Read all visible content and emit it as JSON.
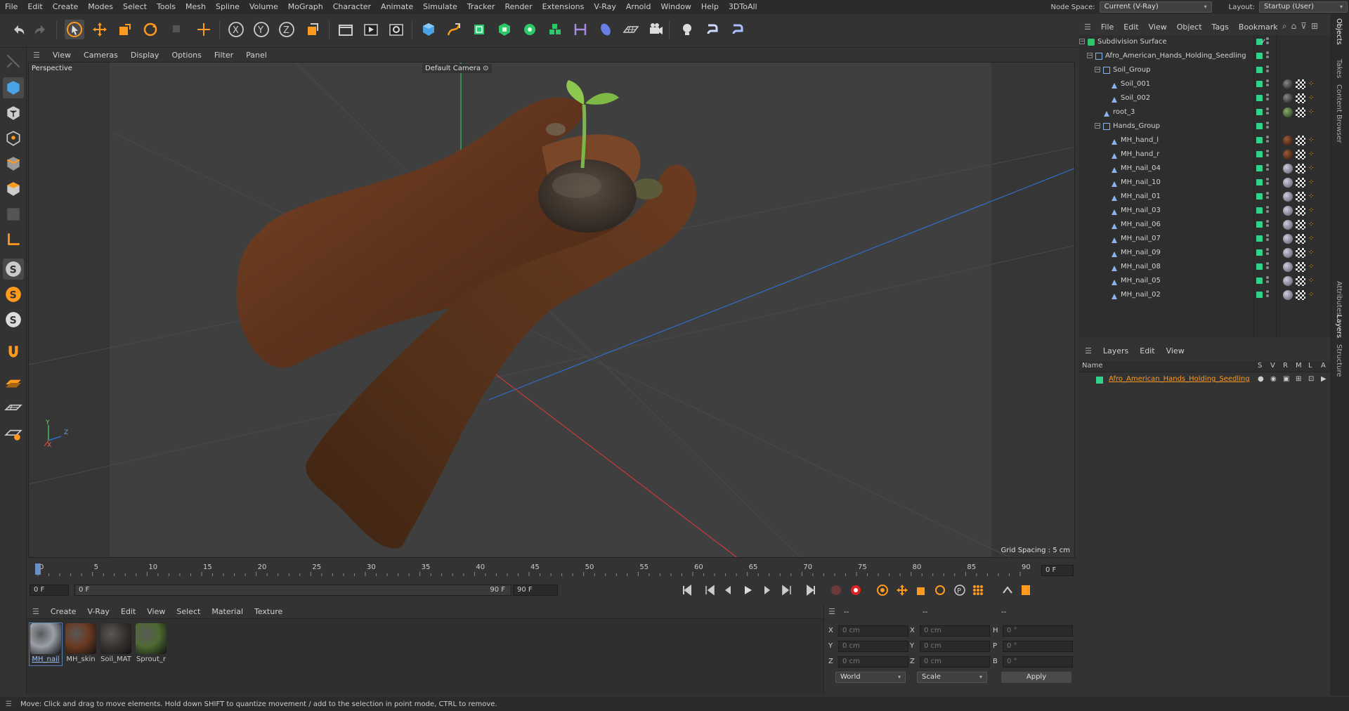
{
  "menubar": {
    "items": [
      "File",
      "Edit",
      "Create",
      "Modes",
      "Select",
      "Tools",
      "Mesh",
      "Spline",
      "Volume",
      "MoGraph",
      "Character",
      "Animate",
      "Simulate",
      "Tracker",
      "Render",
      "Extensions",
      "V-Ray",
      "Arnold",
      "Window",
      "Help",
      "3DToAll"
    ],
    "node_space_label": "Node Space:",
    "node_space_value": "Current (V-Ray)",
    "layout_label": "Layout:",
    "layout_value": "Startup (User)"
  },
  "viewport": {
    "menu": [
      "View",
      "Cameras",
      "Display",
      "Options",
      "Filter",
      "Panel"
    ],
    "view_name": "Perspective",
    "camera_label": "Default Camera",
    "grid_spacing": "Grid Spacing : 5 cm",
    "axis_y": "Y",
    "axis_z": "Z",
    "axis_x": "X"
  },
  "timeline": {
    "ticks": [
      "0",
      "5",
      "10",
      "15",
      "20",
      "25",
      "30",
      "35",
      "40",
      "45",
      "50",
      "55",
      "60",
      "65",
      "70",
      "75",
      "80",
      "85",
      "90"
    ],
    "current_frame_right": "0 F",
    "start_field": "0 F",
    "range_start": "0 F",
    "range_end": "90 F",
    "end_field": "90 F"
  },
  "materials": {
    "menu": [
      "Create",
      "V-Ray",
      "Edit",
      "View",
      "Select",
      "Material",
      "Texture"
    ],
    "items": [
      {
        "name": "MH_nail",
        "color": "#9aa0a8"
      },
      {
        "name": "MH_skin",
        "color": "#6b3a22"
      },
      {
        "name": "Soil_MAT",
        "color": "#3a3430"
      },
      {
        "name": "Sprout_r",
        "color": "#4e6b32"
      }
    ]
  },
  "coordinates": {
    "headers": [
      "--",
      "--",
      "--"
    ],
    "rows": [
      {
        "a": "X",
        "av": "0 cm",
        "b": "X",
        "bv": "0 cm",
        "c": "H",
        "cv": "0 °"
      },
      {
        "a": "Y",
        "av": "0 cm",
        "b": "Y",
        "bv": "0 cm",
        "c": "P",
        "cv": "0 °"
      },
      {
        "a": "Z",
        "av": "0 cm",
        "b": "Z",
        "bv": "0 cm",
        "c": "B",
        "cv": "0 °"
      }
    ],
    "space": "World",
    "mode": "Scale",
    "apply": "Apply"
  },
  "objects": {
    "menu": [
      "File",
      "Edit",
      "View",
      "Object",
      "Tags",
      "Bookmark"
    ],
    "tree": [
      {
        "name": "Subdivision Surface",
        "indent": 0,
        "type": "subd",
        "tags": []
      },
      {
        "name": "Afro_American_Hands_Holding_Seedling",
        "indent": 1,
        "type": "null",
        "tags": []
      },
      {
        "name": "Soil_Group",
        "indent": 2,
        "type": "null",
        "tags": []
      },
      {
        "name": "Soil_001",
        "indent": 3,
        "type": "poly",
        "tags": [
          "soil",
          "check",
          "dots"
        ]
      },
      {
        "name": "Soil_002",
        "indent": 3,
        "type": "poly",
        "tags": [
          "soil",
          "check",
          "dots"
        ]
      },
      {
        "name": "root_3",
        "indent": 2,
        "type": "poly",
        "tags": [
          "sprout",
          "check",
          "dots"
        ]
      },
      {
        "name": "Hands_Group",
        "indent": 2,
        "type": "null",
        "tags": []
      },
      {
        "name": "MH_hand_l",
        "indent": 3,
        "type": "poly",
        "tags": [
          "skin",
          "check",
          "dots"
        ]
      },
      {
        "name": "MH_hand_r",
        "indent": 3,
        "type": "poly",
        "tags": [
          "skin",
          "check",
          "dots"
        ]
      },
      {
        "name": "MH_nail_04",
        "indent": 3,
        "type": "poly",
        "tags": [
          "nail",
          "check",
          "dots"
        ]
      },
      {
        "name": "MH_nail_10",
        "indent": 3,
        "type": "poly",
        "tags": [
          "nail",
          "check",
          "dots"
        ]
      },
      {
        "name": "MH_nail_01",
        "indent": 3,
        "type": "poly",
        "tags": [
          "nail",
          "check",
          "dots"
        ]
      },
      {
        "name": "MH_nail_03",
        "indent": 3,
        "type": "poly",
        "tags": [
          "nail",
          "check",
          "dots"
        ]
      },
      {
        "name": "MH_nail_06",
        "indent": 3,
        "type": "poly",
        "tags": [
          "nail",
          "check",
          "dots"
        ]
      },
      {
        "name": "MH_nail_07",
        "indent": 3,
        "type": "poly",
        "tags": [
          "nail",
          "check",
          "dots"
        ]
      },
      {
        "name": "MH_nail_09",
        "indent": 3,
        "type": "poly",
        "tags": [
          "nail",
          "check",
          "dots"
        ]
      },
      {
        "name": "MH_nail_08",
        "indent": 3,
        "type": "poly",
        "tags": [
          "nail",
          "check",
          "dots"
        ]
      },
      {
        "name": "MH_nail_05",
        "indent": 3,
        "type": "poly",
        "tags": [
          "nail",
          "check",
          "dots"
        ]
      },
      {
        "name": "MH_nail_02",
        "indent": 3,
        "type": "poly",
        "tags": [
          "nail",
          "check",
          "dots"
        ]
      }
    ]
  },
  "layers": {
    "menu": [
      "Layers",
      "Edit",
      "View"
    ],
    "col_name": "Name",
    "cols": [
      "S",
      "V",
      "R",
      "M",
      "L",
      "A"
    ],
    "items": [
      {
        "name": "Afro_American_Hands_Holding_Seedling",
        "color": "#2fd38a"
      }
    ]
  },
  "right_tabs": [
    "Objects",
    "Takes",
    "Content Browser",
    "Attributes",
    "Layers",
    "Structure"
  ],
  "status": "Move: Click and drag to move elements. Hold down SHIFT to quantize movement / add to the selection in point mode, CTRL to remove.",
  "colors": {
    "accent": "#ff9a1f",
    "green": "#2fd38a",
    "selected_blue": "#5a7fb5"
  }
}
